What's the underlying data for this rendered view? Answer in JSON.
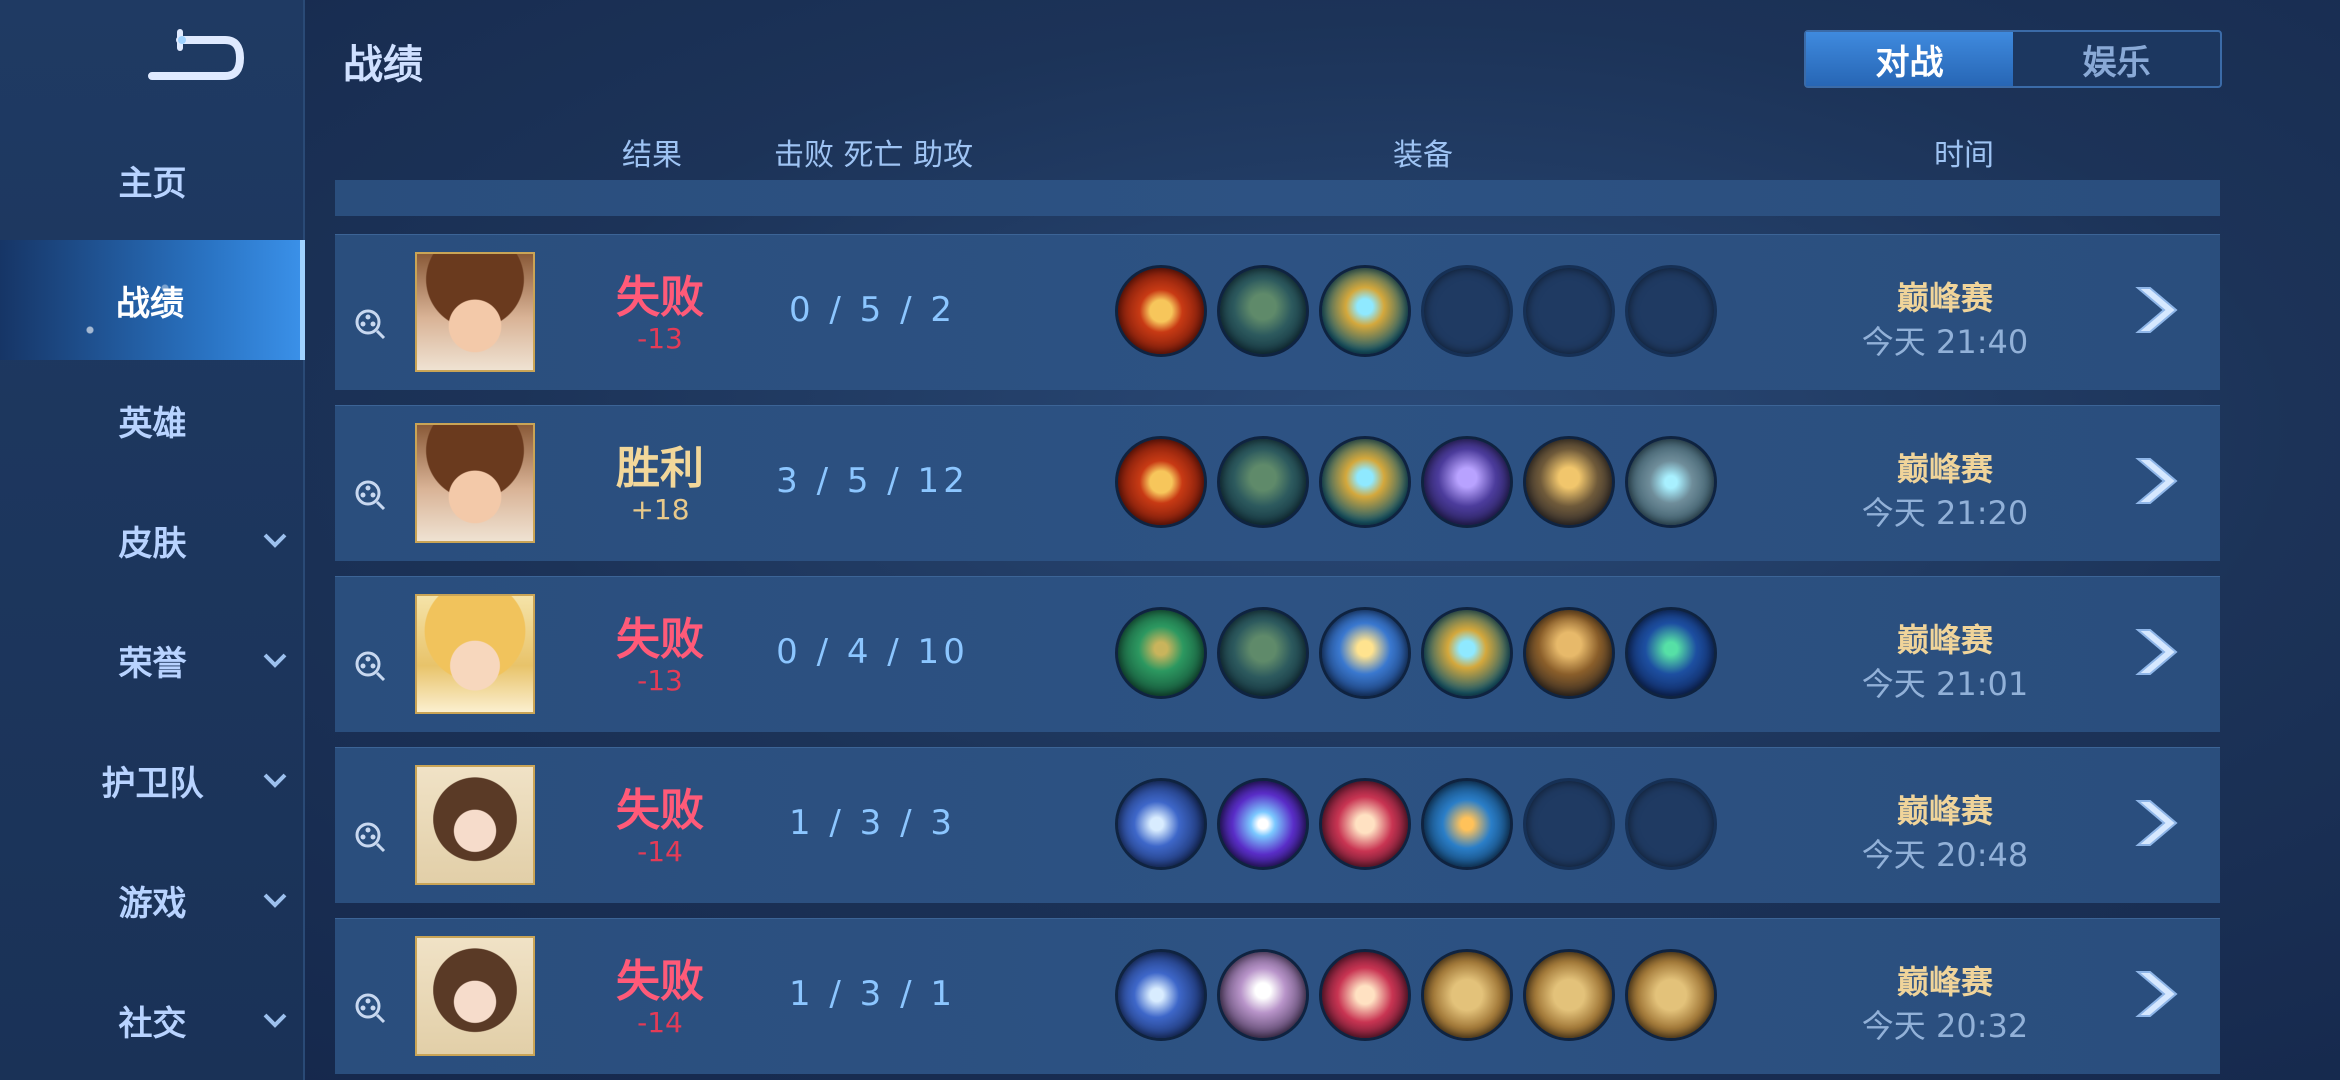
{
  "header": {
    "title": "战绩"
  },
  "mode_switch": {
    "battle": "对战",
    "entertainment": "娱乐"
  },
  "columns": {
    "result": "结果",
    "kda": "击败 死亡 助攻",
    "equipment": "装备",
    "time": "时间"
  },
  "sidebar": {
    "items": [
      {
        "label": "主页",
        "expandable": false,
        "active": false
      },
      {
        "label": "战绩",
        "expandable": false,
        "active": true
      },
      {
        "label": "英雄",
        "expandable": false,
        "active": false
      },
      {
        "label": "皮肤",
        "expandable": true,
        "active": false
      },
      {
        "label": "荣誉",
        "expandable": true,
        "active": false
      },
      {
        "label": "护卫队",
        "expandable": true,
        "active": false
      },
      {
        "label": "游戏",
        "expandable": true,
        "active": false
      },
      {
        "label": "社交",
        "expandable": true,
        "active": false
      }
    ]
  },
  "matches": [
    {
      "hero": "hero-boy-brown-hair",
      "result": "失败",
      "score": "-13",
      "kda": "0 / 5 / 2",
      "mode": "巅峰赛",
      "time": "今天 21:40",
      "items": [
        "red-gold-medallion",
        "green-boots",
        "gold-blue-crest",
        "",
        "",
        ""
      ]
    },
    {
      "hero": "hero-boy-brown-hair",
      "result": "胜利",
      "score": "+18",
      "kda": "3 / 5 / 12",
      "mode": "巅峰赛",
      "time": "今天 21:20",
      "items": [
        "red-gold-medallion",
        "green-boots",
        "gold-blue-crest",
        "purple-armor",
        "gold-chestplate",
        "silver-gem-belt"
      ]
    },
    {
      "hero": "hero-girl-blonde",
      "result": "失败",
      "score": "-13",
      "kda": "0 / 4 / 10",
      "mode": "巅峰赛",
      "time": "今天 21:01",
      "items": [
        "green-jade-amulet",
        "green-boots",
        "blue-hourglass",
        "gold-blue-crest",
        "gold-cloak",
        "blue-hood"
      ]
    },
    {
      "hero": "hero-woman-dark-curls",
      "result": "失败",
      "score": "-14",
      "kda": "1 / 3 / 3",
      "mode": "巅峰赛",
      "time": "今天 20:48",
      "items": [
        "blue-steel-boots",
        "purple-orb",
        "red-spellbook",
        "blue-feather",
        "",
        ""
      ]
    },
    {
      "hero": "hero-woman-dark-curls",
      "result": "失败",
      "score": "-14",
      "kda": "1 / 3 / 1",
      "mode": "巅峰赛",
      "time": "今天 20:32",
      "items": [
        "blue-steel-boots",
        "skull-mask",
        "red-spellbook",
        "wooden-crate",
        "wooden-crate",
        "wooden-crate"
      ]
    }
  ],
  "colors": {
    "lose": "#ff5a78",
    "win": "#f2d79a",
    "mode": "#f0d49a",
    "accent": "#3f8ade"
  }
}
